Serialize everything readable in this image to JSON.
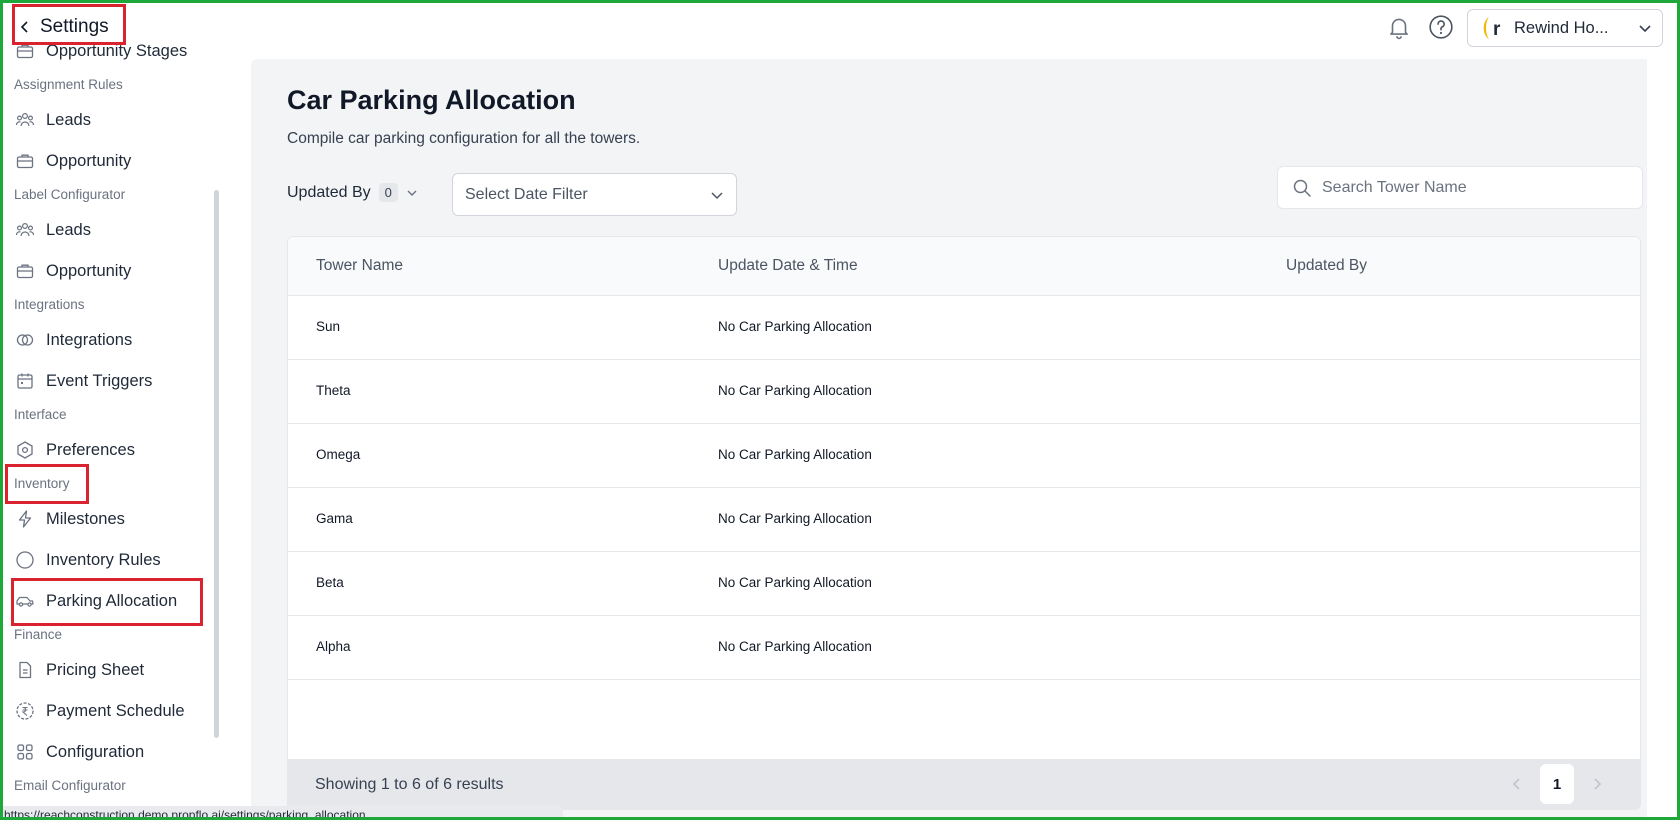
{
  "sidebar": {
    "back_label": "Settings",
    "items": [
      {
        "type": "item",
        "label": "Opportunity Stages",
        "icon": "briefcase-icon"
      },
      {
        "type": "section",
        "label": "Assignment Rules"
      },
      {
        "type": "item",
        "label": "Leads",
        "icon": "users-icon"
      },
      {
        "type": "item",
        "label": "Opportunity",
        "icon": "briefcase-icon"
      },
      {
        "type": "section",
        "label": "Label Configurator"
      },
      {
        "type": "item",
        "label": "Leads",
        "icon": "users-icon"
      },
      {
        "type": "item",
        "label": "Opportunity",
        "icon": "briefcase-icon"
      },
      {
        "type": "section",
        "label": "Integrations"
      },
      {
        "type": "item",
        "label": "Integrations",
        "icon": "link-circles-icon"
      },
      {
        "type": "item",
        "label": "Event Triggers",
        "icon": "calendar-icon"
      },
      {
        "type": "section",
        "label": "Interface"
      },
      {
        "type": "item",
        "label": "Preferences",
        "icon": "hexagon-settings-icon"
      },
      {
        "type": "section",
        "label": "Inventory"
      },
      {
        "type": "item",
        "label": "Milestones",
        "icon": "lightning-icon"
      },
      {
        "type": "item",
        "label": "Inventory Rules",
        "icon": "circle-icon"
      },
      {
        "type": "item",
        "label": "Parking Allocation",
        "icon": "car-icon"
      },
      {
        "type": "section",
        "label": "Finance"
      },
      {
        "type": "item",
        "label": "Pricing Sheet",
        "icon": "document-icon"
      },
      {
        "type": "item",
        "label": "Payment Schedule",
        "icon": "rupee-circle-icon"
      },
      {
        "type": "item",
        "label": "Configuration",
        "icon": "grid-icon"
      },
      {
        "type": "section",
        "label": "Email Configurator"
      }
    ]
  },
  "topbar": {
    "org_initial": "r",
    "org_name": "Rewind Ho...",
    "logo_color": "#f2b705"
  },
  "main": {
    "title": "Car Parking Allocation",
    "subtitle": "Compile car parking configuration for all the towers.",
    "filters": {
      "updated_by_label": "Updated By",
      "updated_by_count": "0",
      "date_filter_placeholder": "Select Date Filter",
      "search_placeholder": "Search Tower Name"
    },
    "table": {
      "columns": [
        "Tower Name",
        "Update Date & Time",
        "Updated By"
      ],
      "rows": [
        [
          "Sun",
          "No Car Parking Allocation",
          ""
        ],
        [
          "Theta",
          "No Car Parking Allocation",
          ""
        ],
        [
          "Omega",
          "No Car Parking Allocation",
          ""
        ],
        [
          "Gama",
          "No Car Parking Allocation",
          ""
        ],
        [
          "Beta",
          "No Car Parking Allocation",
          ""
        ],
        [
          "Alpha",
          "No Car Parking Allocation",
          ""
        ]
      ]
    },
    "pagination": {
      "showing_text": "Showing 1 to 6 of 6 results",
      "current_page": "1"
    }
  },
  "statusbar": {
    "url": "https://reachconstruction.demo.propflo.ai/settings/parking_allocation"
  },
  "colors": {
    "frame_border": "#1fa83a",
    "highlight_border": "#d9232e",
    "main_background": "#f3f4f6"
  }
}
